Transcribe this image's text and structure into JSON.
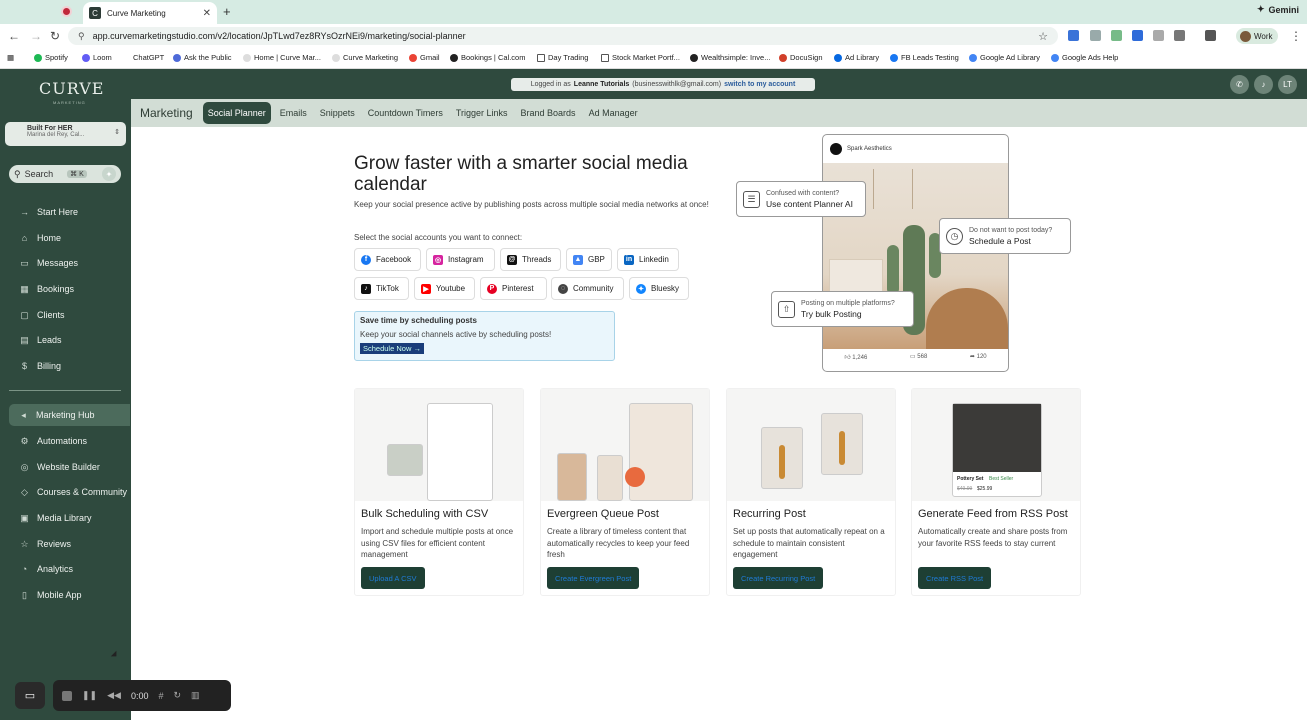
{
  "browser": {
    "tab_title": "Curve Marketing",
    "url": "app.curvemarketingstudio.com/v2/location/JpTLwd7ez8RYsOzrNEi9/marketing/social-planner",
    "gemini_label": "Gemini",
    "profile_label": "Work",
    "bookmarks": [
      "Spotify",
      "Loom",
      "ChatGPT",
      "Ask the Public",
      "Home | Curve Mar...",
      "Curve Marketing",
      "Gmail",
      "Bookings | Cal.com",
      "Day Trading",
      "Stock Market Portf...",
      "Wealthsimple: Inve...",
      "DocuSign",
      "Ad Library",
      "FB Leads Testing",
      "Google Ad Library",
      "Google Ads Help"
    ]
  },
  "app": {
    "logo": "CURVE",
    "logo_sub": "MARKETING",
    "account_name": "Built For HER",
    "account_location": "Marina del Rey, Cal...",
    "search_label": "Search",
    "search_shortcut": "⌘ K",
    "logged_in_prefix": "Logged in as",
    "logged_in_user": "Leanne Tutorials",
    "logged_in_email": "(businesswithlk@gmail.com)",
    "switch_label": "switch to my account",
    "avatar_initials": "LT",
    "nav_top": [
      {
        "label": "Start Here",
        "icon": "→"
      },
      {
        "label": "Home",
        "icon": "⌂"
      },
      {
        "label": "Messages",
        "icon": "▭"
      },
      {
        "label": "Bookings",
        "icon": "▦"
      },
      {
        "label": "Clients",
        "icon": "▢"
      },
      {
        "label": "Leads",
        "icon": "▤"
      },
      {
        "label": "Billing",
        "icon": "$"
      }
    ],
    "nav_bottom": [
      {
        "label": "Marketing Hub",
        "icon": "◂"
      },
      {
        "label": "Automations",
        "icon": "⚙"
      },
      {
        "label": "Website Builder",
        "icon": "◎"
      },
      {
        "label": "Courses & Community",
        "icon": "◇"
      },
      {
        "label": "Media Library",
        "icon": "▣"
      },
      {
        "label": "Reviews",
        "icon": "☆"
      },
      {
        "label": "Analytics",
        "icon": "◔"
      },
      {
        "label": "Mobile App",
        "icon": "▯"
      }
    ]
  },
  "subnav": {
    "title": "Marketing",
    "items": [
      "Social Planner",
      "Emails",
      "Snippets",
      "Countdown Timers",
      "Trigger Links",
      "Brand Boards",
      "Ad Manager"
    ]
  },
  "hero": {
    "title": "Grow faster with a smarter social media calendar",
    "subtitle": "Keep your social presence active by publishing posts across multiple social media networks at once!",
    "select_label": "Select the social accounts you want to connect:",
    "networks": [
      {
        "label": "Facebook",
        "icon": "f",
        "color": "#1877f2"
      },
      {
        "label": "Instagram",
        "icon": "◎",
        "color": "#d6249f"
      },
      {
        "label": "Threads",
        "icon": "@",
        "color": "#111111"
      },
      {
        "label": "GBP",
        "icon": "▲",
        "color": "#4285f4"
      },
      {
        "label": "Linkedin",
        "icon": "in",
        "color": "#0a66c2"
      },
      {
        "label": "TikTok",
        "icon": "♪",
        "color": "#111111"
      },
      {
        "label": "Youtube",
        "icon": "▶",
        "color": "#ff0000"
      },
      {
        "label": "Pinterest",
        "icon": "P",
        "color": "#e60023"
      },
      {
        "label": "Community",
        "icon": "◌",
        "color": "#444444"
      },
      {
        "label": "Bluesky",
        "icon": "✦",
        "color": "#1185fe"
      }
    ],
    "save_title": "Save time by scheduling posts",
    "save_text": "Keep your social channels active by scheduling posts!",
    "save_cta": "Schedule Now  →"
  },
  "phone": {
    "brand": "Spark Aesthetics",
    "likes": "1,246",
    "comments": "568",
    "shares": "120",
    "callout_planner_1": "Confused with content?",
    "callout_planner_2": "Use content Planner AI",
    "callout_schedule_1": "Do not want to post today?",
    "callout_schedule_2": "Schedule a Post",
    "callout_bulk_1": "Posting on multiple platforms?",
    "callout_bulk_2": "Try bulk Posting"
  },
  "cards": [
    {
      "title": "Bulk Scheduling with CSV",
      "desc": "Import and schedule multiple posts at once using CSV files for efficient content management",
      "cta": "Upload A CSV"
    },
    {
      "title": "Evergreen Queue Post",
      "desc": "Create a library of timeless content that automatically recycles to keep your feed fresh",
      "cta": "Create Evergreen Post"
    },
    {
      "title": "Recurring Post",
      "desc": "Set up posts that automatically repeat on a schedule to maintain consistent engagement",
      "cta": "Create Recurring Post"
    },
    {
      "title": "Generate Feed from RSS Post",
      "desc": "Automatically create and share posts from your favorite RSS feeds to stay current",
      "cta": "Create RSS Post",
      "product_name": "Pottery Set",
      "product_badge": "Best Seller",
      "old_price": "$49.99",
      "new_price": "$25.99"
    }
  ],
  "recorder": {
    "time": "0:00"
  }
}
